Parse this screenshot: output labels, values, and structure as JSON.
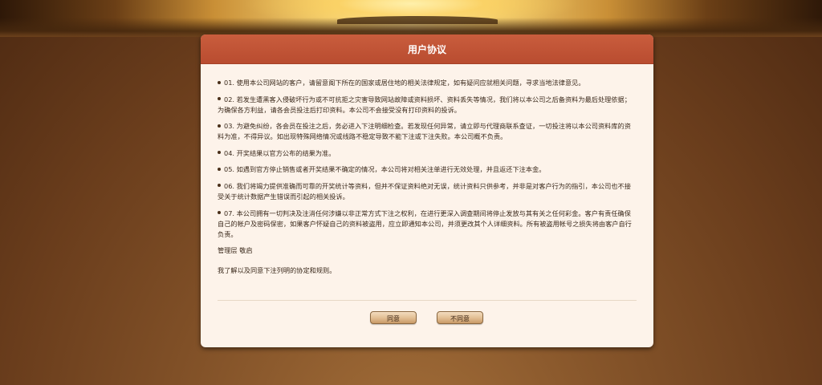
{
  "header": {
    "title": "用户协议"
  },
  "clauses": [
    "01. 使用本公司网站的客户，请留意阁下所在的国家或居住地的相关法律规定，如有疑问应就相关问题，寻求当地法律意见。",
    "02. 若发生遭黑客入侵破坏行为或不可抗拒之灾害导致网站故障或资料损坏、资料丢失等情况，我们将以本公司之后备资料为最后处理依据；为确保各方利益，请各会员投注后打印资料。本公司不会接受没有打印资料的投诉。",
    "03. 为避免纠纷，各会员在投注之后，务必进入下注明细检查。若发现任何异常，请立即与代理商联系查证，一切投注将以本公司资料库的资料为准，不得异议。如出现特殊网络情况或线路不稳定导致不能下注或下注失败。本公司概不负责。",
    "04. 开奖结果以官方公布的结果为准。",
    "05. 如遇到官方停止销售或者开奖结果不确定的情况，本公司将对相关注单进行无效处理，并且返还下注本金。",
    "06. 我们将竭力提供准确而可靠的开奖统计等资料，但并不保证资料绝对无误，统计资料只供参考，并非是对客户行为的指引，本公司也不接受关于统计数据产生错误而引起的相关投诉。",
    "07. 本公司拥有一切判决及注消任何涉嫌以非正常方式下注之权利，在进行更深入调查期间将停止发放与其有关之任何彩金。客户有责任确保自己的帐户及密码保密，如果客户怀疑自己的资料被盗用，应立即通知本公司，并须更改其个人详细资料。所有被盗用帐号之损失将由客户自行负责。"
  ],
  "signature": "管理层 敬启",
  "agreement_statement": "我了解以及同意下注列明的协定和规则。",
  "buttons": {
    "agree_label": "同意",
    "disagree_label": "不同意"
  },
  "colors": {
    "header_bg": "#bf5235",
    "panel_bg": "#fdf3ea",
    "button_bg": "#e1bd92"
  }
}
